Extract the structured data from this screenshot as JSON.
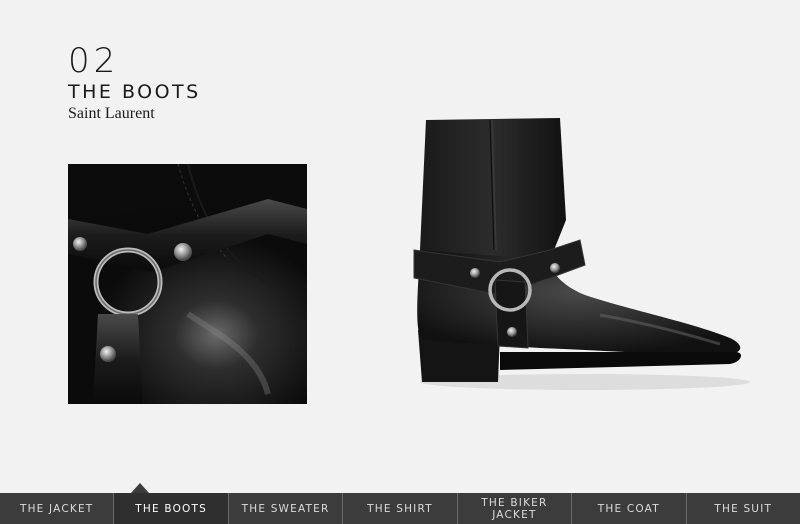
{
  "feature": {
    "number": "02",
    "title": "THE BOOTS",
    "brand": "Saint Laurent"
  },
  "images": {
    "detail": "boot-harness-closeup",
    "product": "saint-laurent-harness-ankle-boot"
  },
  "nav": {
    "items": [
      {
        "label": "THE JACKET"
      },
      {
        "label": "THE BOOTS",
        "active": true
      },
      {
        "label": "THE SWEATER"
      },
      {
        "label": "THE SHIRT"
      },
      {
        "label": "THE BIKER JACKET"
      },
      {
        "label": "THE COAT"
      },
      {
        "label": "THE SUIT"
      }
    ]
  },
  "colors": {
    "background": "#f2f2f2",
    "nav_background": "#3c3c3c",
    "text": "#1a1a1a"
  }
}
